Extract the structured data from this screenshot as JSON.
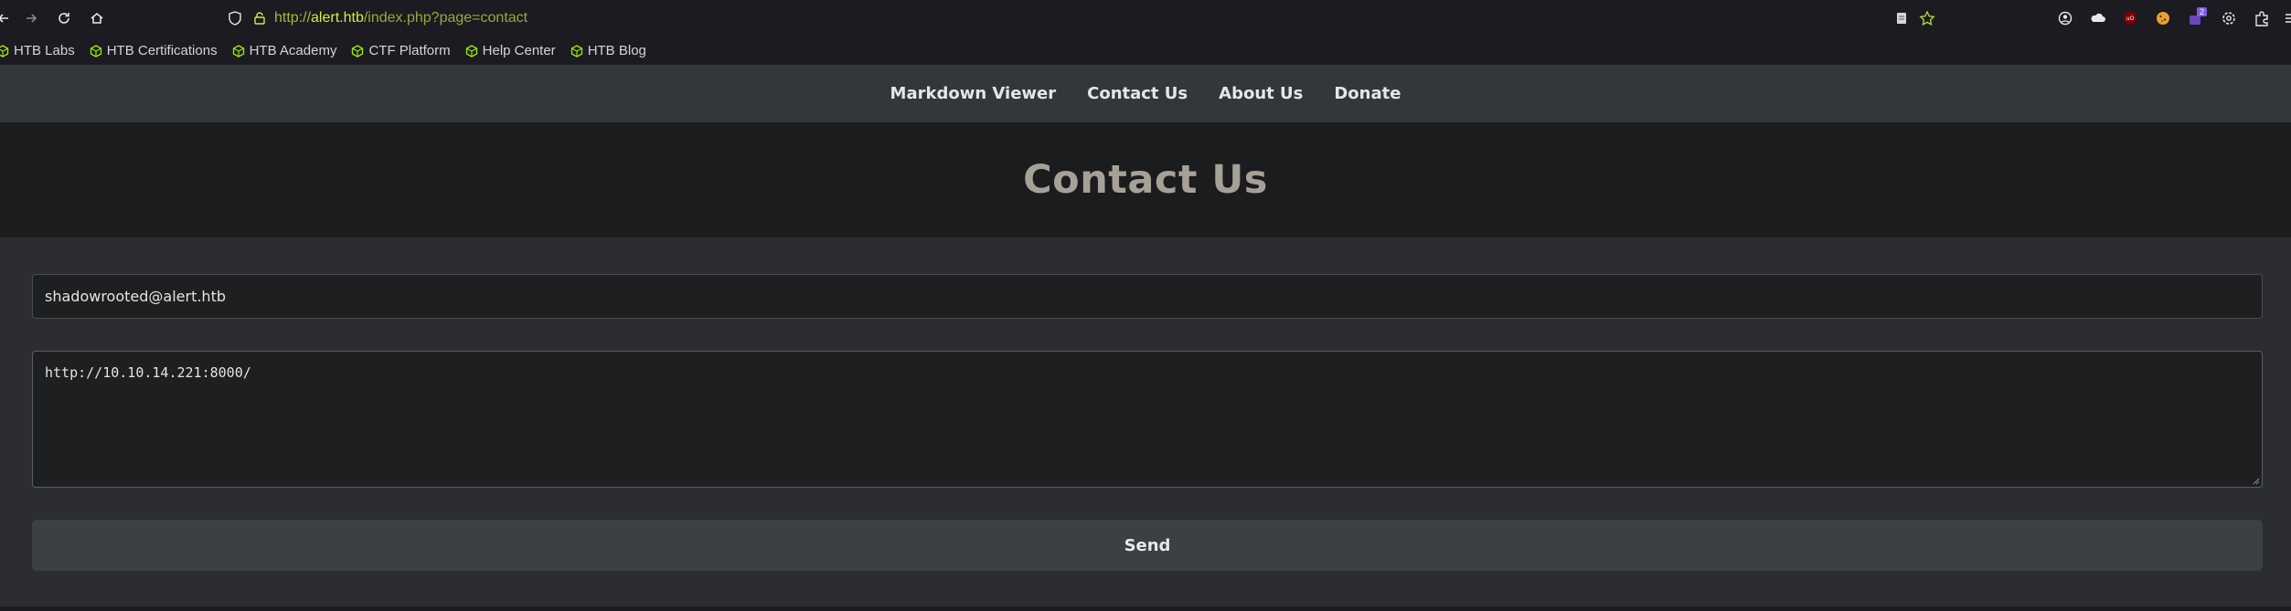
{
  "browser": {
    "url_prefix": "http://",
    "url_host": "alert.htb",
    "url_path": "/index.php?page=contact",
    "extension_badge": "2",
    "bookmarks": [
      {
        "label": "HTB Labs"
      },
      {
        "label": "HTB Certifications"
      },
      {
        "label": "HTB Academy"
      },
      {
        "label": "CTF Platform"
      },
      {
        "label": "Help Center"
      },
      {
        "label": "HTB Blog"
      }
    ]
  },
  "nav": {
    "items": [
      {
        "label": "Markdown Viewer"
      },
      {
        "label": "Contact Us"
      },
      {
        "label": "About Us"
      },
      {
        "label": "Donate"
      }
    ]
  },
  "page": {
    "title": "Contact Us"
  },
  "form": {
    "email_value": "shadowrooted@alert.htb",
    "message_value": "http://10.10.14.221:8000/",
    "send_label": "Send"
  }
}
